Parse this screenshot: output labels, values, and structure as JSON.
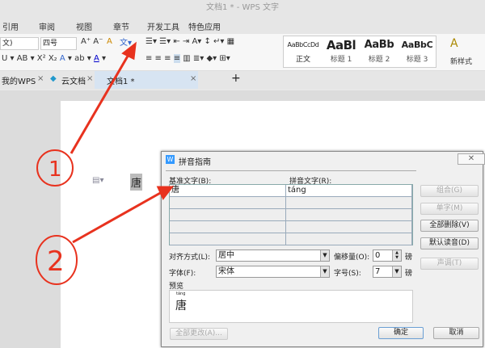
{
  "window": {
    "title": "文档1 * - WPS 文字"
  },
  "menu": [
    "引用",
    "审阅",
    "视图",
    "章节",
    "开发工具",
    "特色应用"
  ],
  "ribbon": {
    "font_name": "文)",
    "font_size": "四号",
    "styles": [
      {
        "preview": "AaBbCcDd",
        "label": "正文"
      },
      {
        "preview": "AaBl",
        "label": "标题 1"
      },
      {
        "preview": "AaBb",
        "label": "标题 2"
      },
      {
        "preview": "AaBbC",
        "label": "标题 3"
      }
    ],
    "new_style": "新样式"
  },
  "tabs": [
    {
      "label": "我的WPS"
    },
    {
      "label": "云文档"
    },
    {
      "label": "文档1 *"
    }
  ],
  "document": {
    "text": "唐"
  },
  "annotations": {
    "one": "1",
    "two": "2"
  },
  "dialog": {
    "title": "拼音指南",
    "base_label": "基准文字(B):",
    "ruby_label": "拼音文字(R):",
    "rows": [
      {
        "base": "唐",
        "ruby": "táng"
      },
      {
        "base": "",
        "ruby": ""
      },
      {
        "base": "",
        "ruby": ""
      },
      {
        "base": "",
        "ruby": ""
      },
      {
        "base": "",
        "ruby": ""
      }
    ],
    "buttons": {
      "group": "组合(G)",
      "single": "单字(M)",
      "clear_all": "全部删除(V)",
      "default_reading": "默认读音(D)",
      "tone": "声调(T)",
      "change_all": "全部更改(A)...",
      "ok": "确定",
      "cancel": "取消"
    },
    "align_label": "对齐方式(L):",
    "align_value": "居中",
    "offset_label": "偏移量(O):",
    "offset_value": "0",
    "font_label": "字体(F):",
    "font_value": "宋体",
    "size_label": "字号(S):",
    "size_value": "7",
    "unit": "磅",
    "preview_label": "预览",
    "preview_ruby": "táng",
    "preview_base": "唐"
  }
}
